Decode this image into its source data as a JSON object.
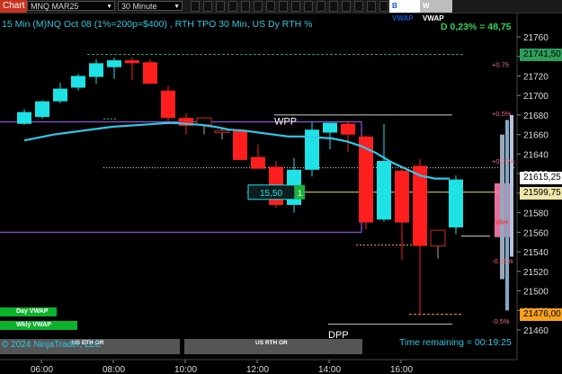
{
  "toolbar": {
    "chart_tab": "Chart",
    "instrument": "MNQ MAR25",
    "timeframe": "30 Minute",
    "b_vwap": "B VWAP",
    "w_vwap": "W VWAP"
  },
  "header": {
    "info_text": "15 Min (M)NQ Oct 08 (1%=200p=$400) , RTH TPO 30 Min, US Dy RTH %",
    "delta_text": "D 0,23% = 48,75"
  },
  "chart_data": {
    "type": "candlestick",
    "x_ticks": [
      "06:00",
      "08:00",
      "10:00",
      "12:00",
      "14:00",
      "16:00"
    ],
    "y_ticks": [
      21760,
      21740,
      21720,
      21700,
      21680,
      21660,
      21640,
      21620,
      21600,
      21580,
      21560,
      21540,
      21520,
      21500,
      21480,
      21460
    ],
    "ylim": [
      21452,
      21774
    ],
    "candles": [
      {
        "o": 21671,
        "h": 21686,
        "l": 21670,
        "c": 21683,
        "dir": "up"
      },
      {
        "o": 21678,
        "h": 21695,
        "l": 21676,
        "c": 21694,
        "dir": "up"
      },
      {
        "o": 21694,
        "h": 21713,
        "l": 21692,
        "c": 21707,
        "dir": "up"
      },
      {
        "o": 21708,
        "h": 21722,
        "l": 21705,
        "c": 21720,
        "dir": "up"
      },
      {
        "o": 21719,
        "h": 21737,
        "l": 21712,
        "c": 21733,
        "dir": "up"
      },
      {
        "o": 21729,
        "h": 21739,
        "l": 21717,
        "c": 21736,
        "dir": "up"
      },
      {
        "o": 21736,
        "h": 21739,
        "l": 21716,
        "c": 21733,
        "dir": "down"
      },
      {
        "o": 21734,
        "h": 21737,
        "l": 21712,
        "c": 21712,
        "dir": "down"
      },
      {
        "o": 21705,
        "h": 21710,
        "l": 21671,
        "c": 21677,
        "dir": "down"
      },
      {
        "o": 21677,
        "h": 21682,
        "l": 21660,
        "c": 21669,
        "dir": "down"
      },
      {
        "o": 21670,
        "h": 21676,
        "l": 21660,
        "c": 21677,
        "dir": "down"
      },
      {
        "o": 21662,
        "h": 21666,
        "l": 21655,
        "c": 21664,
        "dir": "down"
      },
      {
        "o": 21664,
        "h": 21666,
        "l": 21650,
        "c": 21634,
        "dir": "down"
      },
      {
        "o": 21637,
        "h": 21650,
        "l": 21637,
        "c": 21625,
        "dir": "down"
      },
      {
        "o": 21627,
        "h": 21633,
        "l": 21585,
        "c": 21588,
        "dir": "down"
      },
      {
        "o": 21588,
        "h": 21636,
        "l": 21580,
        "c": 21624,
        "dir": "up"
      },
      {
        "o": 21624,
        "h": 21673,
        "l": 21617,
        "c": 21665,
        "dir": "up"
      },
      {
        "o": 21662,
        "h": 21672,
        "l": 21645,
        "c": 21672,
        "dir": "up"
      },
      {
        "o": 21671,
        "h": 21674,
        "l": 21642,
        "c": 21660,
        "dir": "down"
      },
      {
        "o": 21658,
        "h": 21659,
        "l": 21563,
        "c": 21570,
        "dir": "down"
      },
      {
        "o": 21573,
        "h": 21671,
        "l": 21571,
        "c": 21633,
        "dir": "up"
      },
      {
        "o": 21623,
        "h": 21628,
        "l": 21532,
        "c": 21570,
        "dir": "down"
      },
      {
        "o": 21628,
        "h": 21635,
        "l": 21475,
        "c": 21546,
        "dir": "down"
      },
      {
        "o": 21546,
        "h": 21562,
        "l": 21533,
        "c": 21562,
        "dir": "down"
      },
      {
        "o": 21565,
        "h": 21618,
        "l": 21558,
        "c": 21614,
        "dir": "up"
      }
    ],
    "vwap_line": [
      21654,
      21657,
      21660,
      21662,
      21664,
      21666,
      21668,
      21669,
      21670,
      21671,
      21672,
      21671,
      21670,
      21668,
      21665,
      21664,
      21662,
      21660,
      21658,
      21658,
      21657,
      21656,
      21653,
      21648,
      21641,
      21632,
      21625,
      21618,
      21615,
      21615
    ],
    "pct_labels": [
      {
        "text": "+0.75",
        "price": 21732
      },
      {
        "text": "+0.5%",
        "price": 21682
      },
      {
        "text": "+0.25%",
        "price": 21633
      },
      {
        "text": "-0.25%",
        "price": 21531
      },
      {
        "text": "-0.5%",
        "price": 21469
      }
    ],
    "line_labels": [
      {
        "text": "WPP",
        "price": 21676
      },
      {
        "text": "DPP",
        "price": 21462
      }
    ],
    "box_label": {
      "text": "15,50",
      "price": 21601
    },
    "box_badge": "1",
    "value_area_label": "VAH",
    "price_badges": [
      {
        "text": "21741,50",
        "price": 21741.5,
        "bg": "#2ca05a",
        "fg": "#000000"
      },
      {
        "text": "21615,25",
        "price": 21615.25,
        "bg": "#ffffff",
        "fg": "#000000"
      },
      {
        "text": "21599,75",
        "price": 21599.75,
        "bg": "#efe6a8",
        "fg": "#000000"
      },
      {
        "text": "21476,00",
        "price": 21476,
        "bg": "#f7a01c",
        "fg": "#000000"
      }
    ],
    "colors": {
      "up": "#1ee2e6",
      "down": "#ff1e1e",
      "vwap": "#31c8e6",
      "wpp": "#9b55e6",
      "session": "#f7a01c"
    }
  },
  "legend": {
    "day_vwap": "Day VWAP",
    "wkly_vwap": "Wkly VWAP"
  },
  "sessions": {
    "eth_label": "US ETH OR",
    "rth_label": "US RTH OR"
  },
  "footer": {
    "copyright": "© 2024 NinjaTrader, LLC",
    "time_remaining": "Time remaining = 00:19:25"
  }
}
